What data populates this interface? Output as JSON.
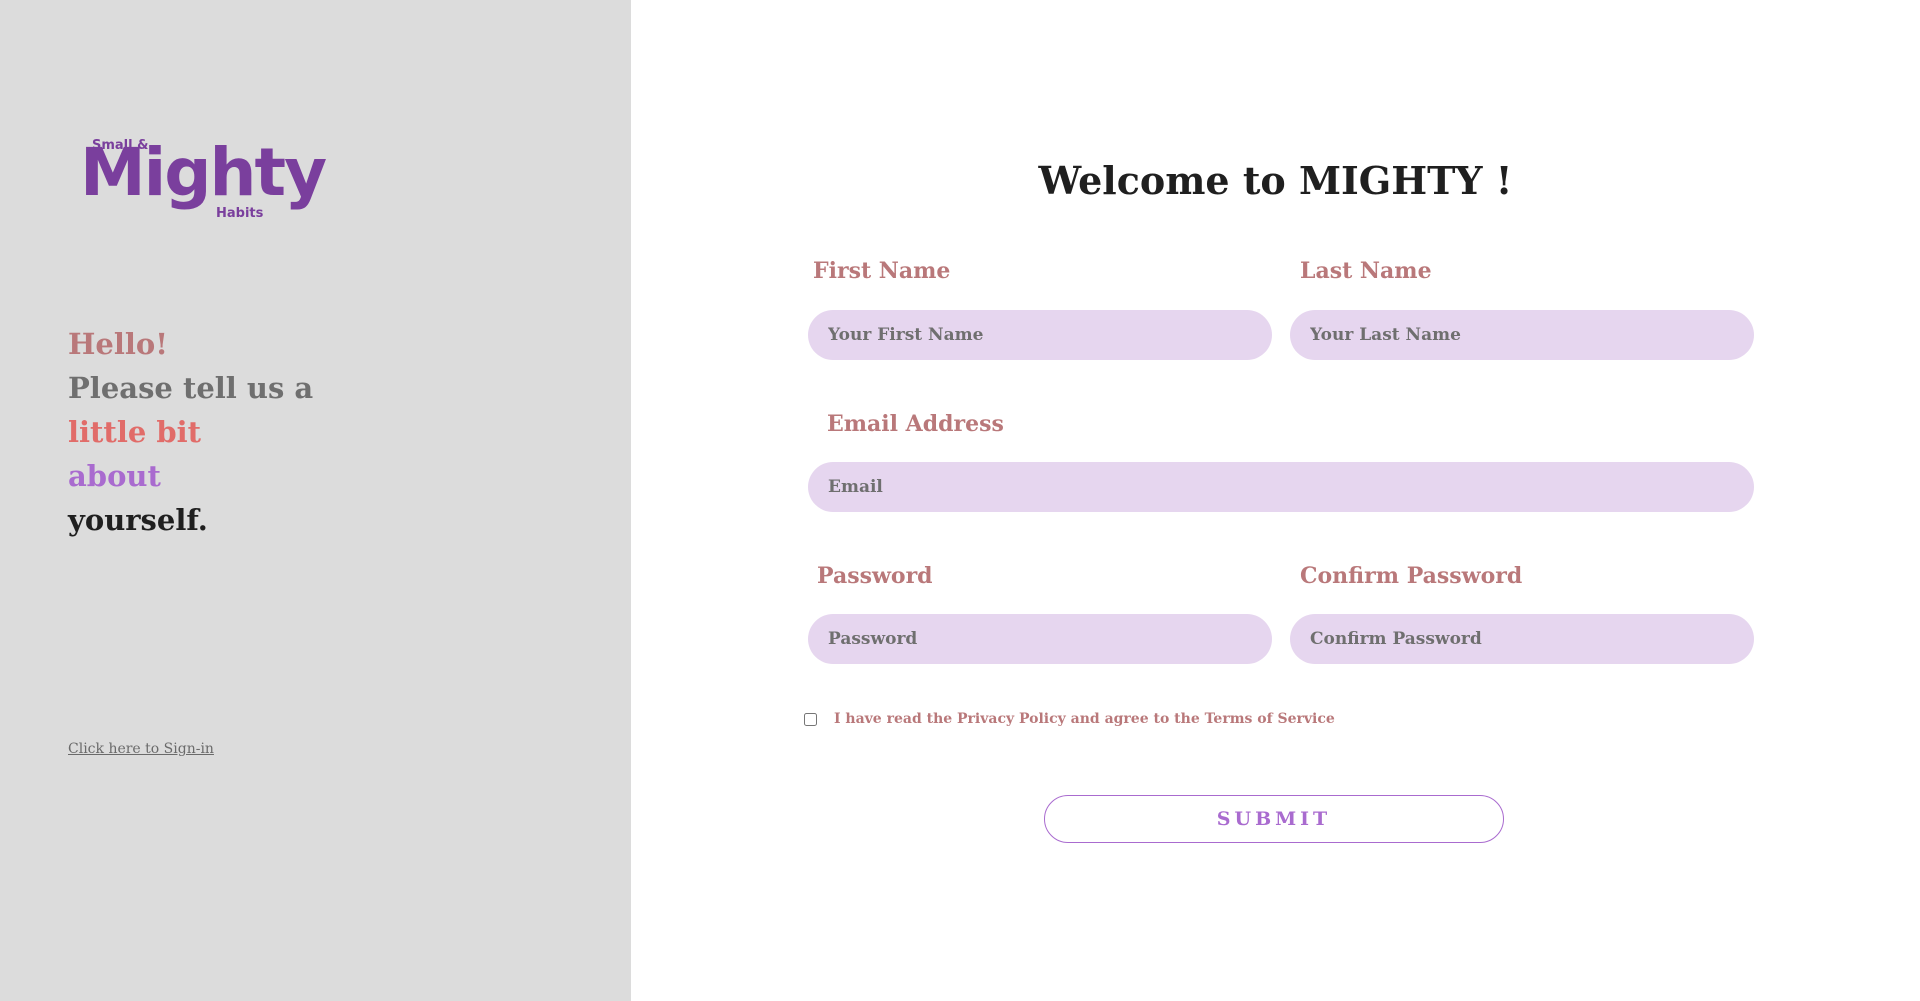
{
  "brand": {
    "logo_small": "Small &",
    "logo_main": "Mighty",
    "logo_sub": "Habits",
    "color": "#7a3f9d"
  },
  "intro": {
    "line1": "Hello!",
    "line2": "Please tell us a",
    "line3": "little bit",
    "line4": "about",
    "line5": "yourself."
  },
  "signin_link": "Click here to Sign-in",
  "form": {
    "title": "Welcome to MIGHTY !",
    "first_name": {
      "label": "First Name",
      "placeholder": "Your First Name",
      "value": ""
    },
    "last_name": {
      "label": "Last Name",
      "placeholder": "Your Last Name",
      "value": ""
    },
    "email": {
      "label": "Email Address",
      "placeholder": "Email",
      "value": ""
    },
    "password": {
      "label": "Password",
      "placeholder": "Password",
      "value": ""
    },
    "confirm_password": {
      "label": "Confirm Password",
      "placeholder": "Confirm Password",
      "value": ""
    },
    "agreement": {
      "text": "I have read the Privacy Policy and agree to the Terms of Service",
      "checked": false
    },
    "submit_label": "SUBMIT"
  },
  "colors": {
    "left_bg": "#dcdcdc",
    "label": "#b9787a",
    "input_bg": "#e6d6ef",
    "accent": "#a96bcf"
  }
}
